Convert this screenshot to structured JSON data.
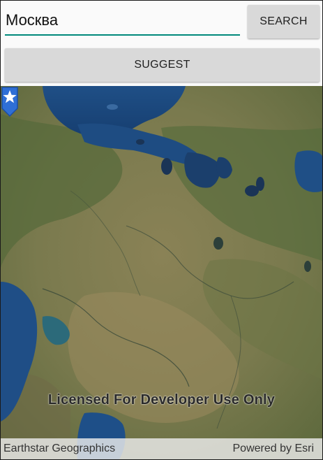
{
  "search": {
    "value": "Москва",
    "button_label": "SEARCH"
  },
  "suggest": {
    "button_label": "SUGGEST"
  },
  "map": {
    "watermark": "Licensed For Developer Use Only",
    "attribution_left": "Earthstar Geographics",
    "attribution_right": "Powered by Esri",
    "marker_icon": "star-pin-icon",
    "marker_color": "#2f6fd6"
  }
}
